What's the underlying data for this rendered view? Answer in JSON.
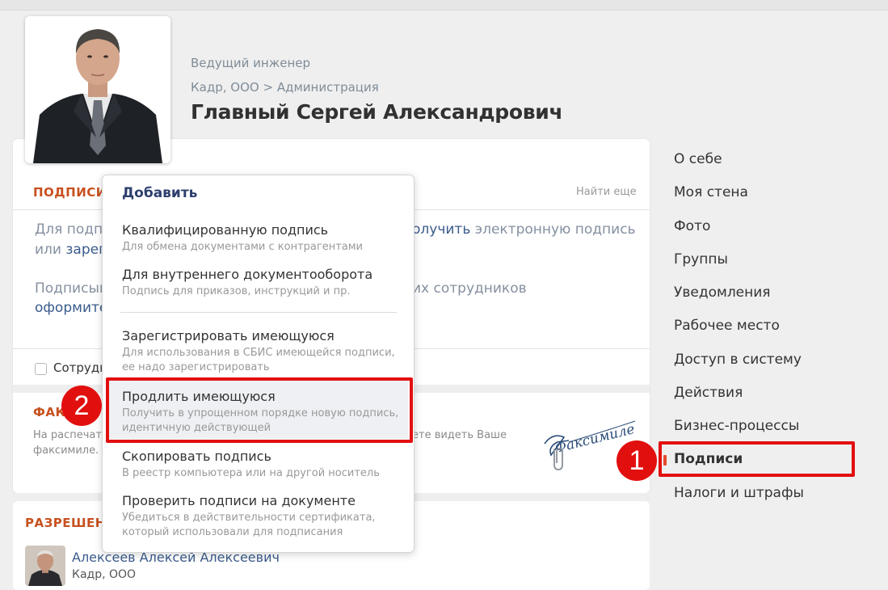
{
  "profile": {
    "position": "Ведущий инженер",
    "org": "Кадр, ООО",
    "department": "Администрация",
    "breadcrumb_sep": ">",
    "name": "Главный Сергей Александрович"
  },
  "signatures": {
    "title": "ПОДПИСИ",
    "find_more": "Найти еще",
    "para1_line1_start": "Для подпи",
    "para1_line1_link": "олучить",
    "para1_line1_end": " электронную подпись",
    "para1_line2_start": "или ",
    "para1_line2_link": "зареги",
    "para2_line1_start": "Подписыв",
    "para2_line1_end": "их сотрудников",
    "para2_line2_link": "оформите",
    "employees_checkbox_label": "Сотрудн"
  },
  "facsimile": {
    "title": "ФАКС",
    "text_line1_start": "На распечата",
    "text_line1_end": "ете видеть Ваше",
    "text_line2": "факсимиле. Д",
    "signature_image_text": "Факсимиле"
  },
  "permissions": {
    "title": "РАЗРЕШЕН",
    "person_name": "Алексеев Алексей Алексеевич",
    "person_org": "Кадр, ООО"
  },
  "nav": {
    "items": [
      {
        "label": "О себе"
      },
      {
        "label": "Моя стена"
      },
      {
        "label": "Фото"
      },
      {
        "label": "Группы"
      },
      {
        "label": "Уведомления"
      },
      {
        "label": "Рабочее место"
      },
      {
        "label": "Доступ в систему"
      },
      {
        "label": "Действия"
      },
      {
        "label": "Бизнес-процессы"
      },
      {
        "label": "Подписи",
        "active": true
      },
      {
        "label": "Налоги и штрафы"
      }
    ]
  },
  "popup": {
    "title": "Добавить",
    "items": [
      {
        "title": "Квалифицированную подпись",
        "subtitle": "Для обмена документами с контрагентами"
      },
      {
        "title": "Для внутреннего документооборота",
        "subtitle": "Подпись для приказов, инструкций и пр."
      },
      {
        "title": "Зарегистрировать имеющуюся",
        "subtitle_l1": "Для использования в СБИС имеющейся подписи,",
        "subtitle_l2": "ее надо зарегистрировать"
      },
      {
        "title": "Продлить имеющуюся",
        "subtitle_l1": "Получить в упрощенном порядке новую подпись,",
        "subtitle_l2": "идентичную действующей",
        "highlighted": true
      },
      {
        "title": "Скопировать подпись",
        "subtitle": "В реестр компьютера или на другой носитель"
      },
      {
        "title": "Проверить подписи на документе",
        "subtitle_l1": "Убедиться в действительности сертификата,",
        "subtitle_l2": "который использовали для подписания"
      }
    ]
  },
  "annotations": {
    "step1": "1",
    "step2": "2",
    "color": "#e20f0f"
  },
  "colors": {
    "accent_orange": "#c7511f",
    "link_blue": "#3a5b8c",
    "active_marker": "#e34a2f"
  }
}
